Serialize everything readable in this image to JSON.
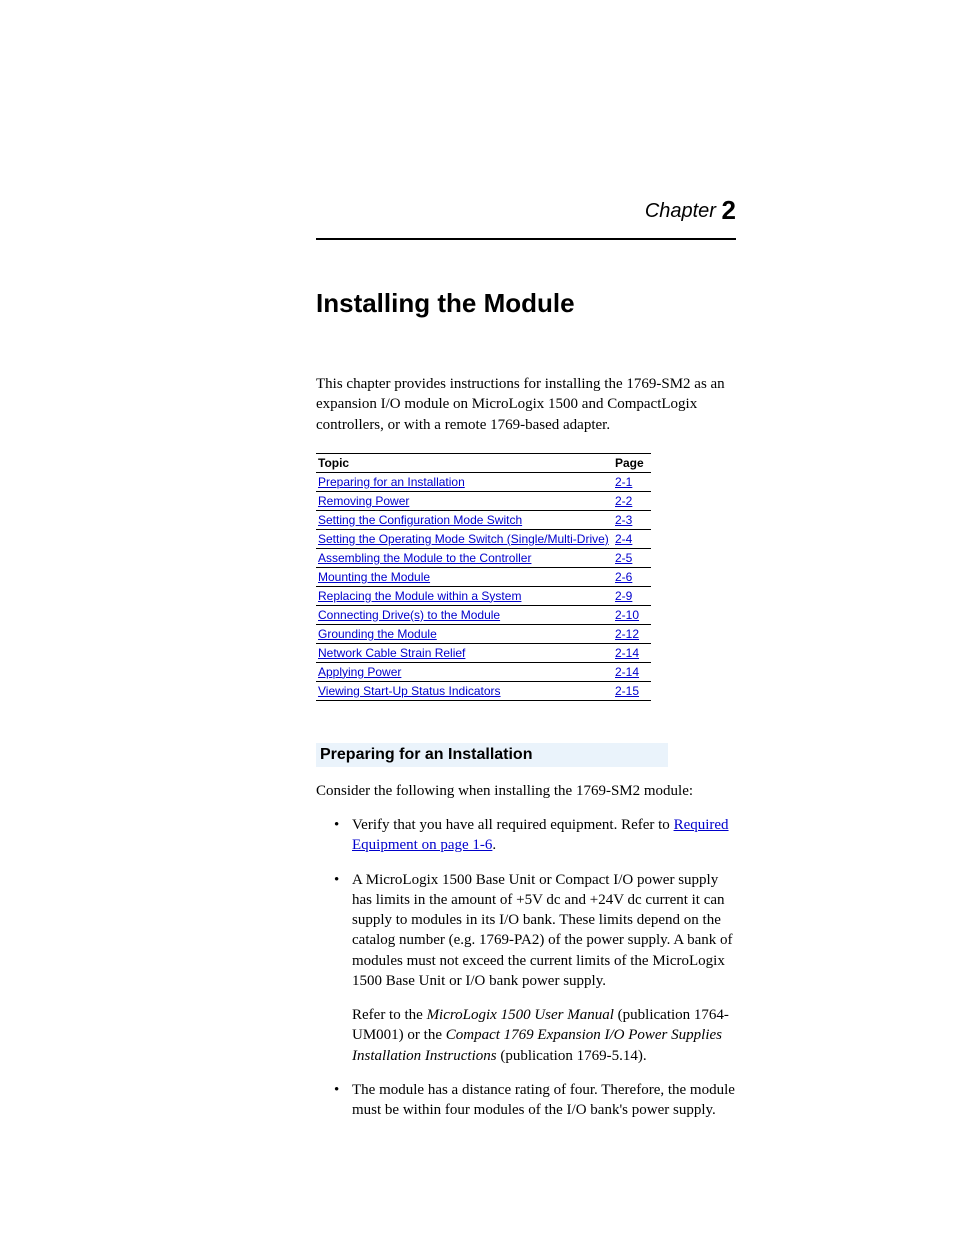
{
  "chapter_label": "Chapter",
  "chapter_number": "2",
  "title": "Installing the Module",
  "intro": "This chapter provides instructions for installing the 1769-SM2 as an expansion I/O module on MicroLogix 1500 and CompactLogix controllers, or with a remote 1769-based adapter.",
  "toc": {
    "headers": {
      "topic": "Topic",
      "page": "Page"
    },
    "rows": [
      {
        "topic": "Preparing for an Installation",
        "page": "2-1"
      },
      {
        "topic": "Removing Power",
        "page": "2-2"
      },
      {
        "topic": "Setting the Configuration Mode Switch",
        "page": "2-3"
      },
      {
        "topic": "Setting the Operating Mode Switch (Single/Multi-Drive)",
        "page": "2-4"
      },
      {
        "topic": "Assembling the Module to the Controller",
        "page": "2-5"
      },
      {
        "topic": "Mounting the Module",
        "page": "2-6"
      },
      {
        "topic": "Replacing the Module within a System",
        "page": "2-9"
      },
      {
        "topic": "Connecting Drive(s) to the Module",
        "page": "2-10"
      },
      {
        "topic": "Grounding the Module",
        "page": "2-12"
      },
      {
        "topic": "Network Cable Strain Relief",
        "page": "2-14"
      },
      {
        "topic": "Applying Power",
        "page": "2-14"
      },
      {
        "topic": "Viewing Start-Up Status Indicators",
        "page": "2-15"
      }
    ]
  },
  "section_heading": "Preparing for an Installation",
  "section_lead": "Consider the following when installing the 1769-SM2 module:",
  "bullets": {
    "b1_pre": "Verify that you have all required equipment. Refer to ",
    "b1_link": "Required Equipment on page 1-6",
    "b1_post": ".",
    "b2_main": "A MicroLogix 1500 Base Unit or Compact I/O power supply has limits in the amount of +5V dc and +24V dc current it can supply to modules in its I/O bank. These limits depend on the catalog number (e.g. 1769-PA2) of the power supply. A bank of modules must not exceed the current limits of the MicroLogix 1500 Base Unit or I/O bank power supply.",
    "b2_sub_pre": "Refer to the ",
    "b2_sub_ital1": "MicroLogix 1500 User Manual",
    "b2_sub_mid": " (publication 1764-UM001)  or the ",
    "b2_sub_ital2": "Compact 1769 Expansion I/O Power Supplies Installation Instructions",
    "b2_sub_post": " (publication 1769-5.14).",
    "b3": "The module has a distance rating of four. Therefore, the module must be within four modules of the I/O bank's power supply."
  }
}
